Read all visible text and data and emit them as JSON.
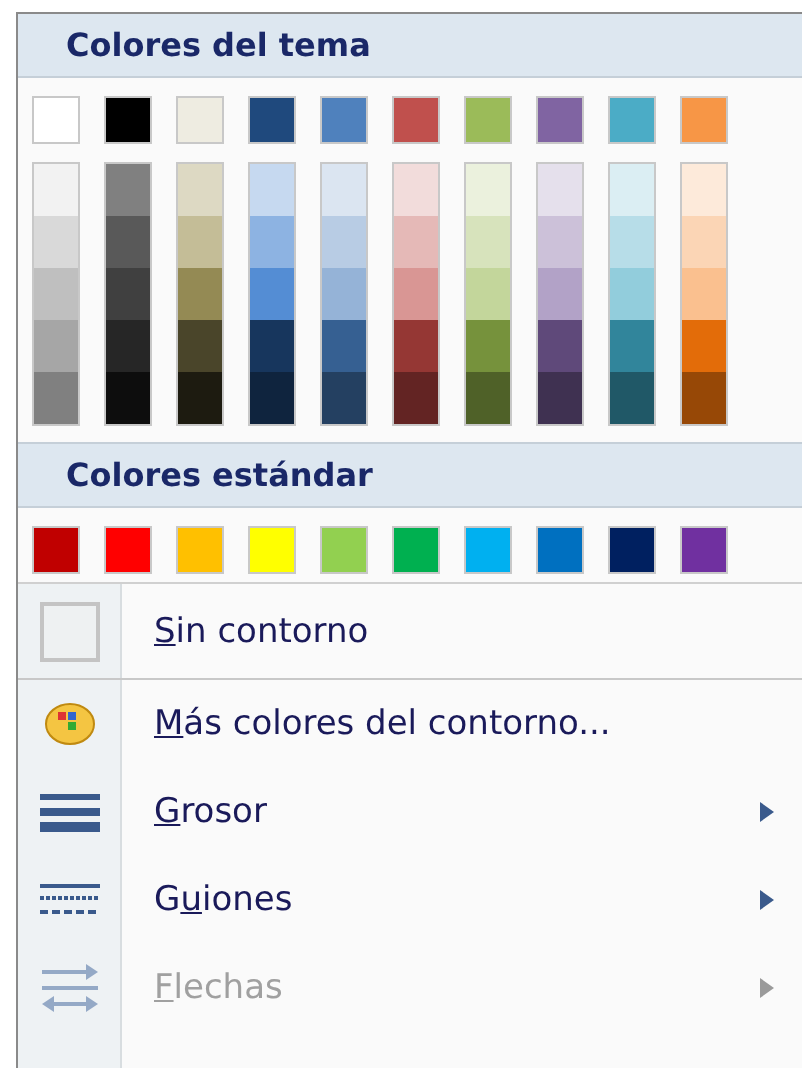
{
  "theme_section": {
    "title": "Colores del tema",
    "base_colors": [
      {
        "color": "#ffffff"
      },
      {
        "color": "#000000"
      },
      {
        "color": "#eeece1"
      },
      {
        "color": "#1f497d"
      },
      {
        "color": "#4f81bd"
      },
      {
        "color": "#c0504d"
      },
      {
        "color": "#9bbb59"
      },
      {
        "color": "#8064a2"
      },
      {
        "color": "#4bacc6"
      },
      {
        "color": "#f79646"
      }
    ],
    "shade_columns": [
      {
        "shades": [
          {
            "color": "#f2f2f2"
          },
          {
            "color": "#d9d9d9"
          },
          {
            "color": "#bfbfbf"
          },
          {
            "color": "#a6a6a6"
          },
          {
            "color": "#808080"
          }
        ]
      },
      {
        "shades": [
          {
            "color": "#808080"
          },
          {
            "color": "#595959"
          },
          {
            "color": "#404040"
          },
          {
            "color": "#262626"
          },
          {
            "color": "#0d0d0d"
          }
        ]
      },
      {
        "shades": [
          {
            "color": "#ddd9c3"
          },
          {
            "color": "#c4bd97"
          },
          {
            "color": "#948a54"
          },
          {
            "color": "#4a452a"
          },
          {
            "color": "#1d1b10"
          }
        ]
      },
      {
        "shades": [
          {
            "color": "#c6d9f0"
          },
          {
            "color": "#8db3e2"
          },
          {
            "color": "#548dd4"
          },
          {
            "color": "#17365d"
          },
          {
            "color": "#0f243e"
          }
        ]
      },
      {
        "shades": [
          {
            "color": "#dbe5f1"
          },
          {
            "color": "#b8cce4"
          },
          {
            "color": "#95b3d7"
          },
          {
            "color": "#366092"
          },
          {
            "color": "#244061"
          }
        ]
      },
      {
        "shades": [
          {
            "color": "#f2dcdb"
          },
          {
            "color": "#e5b9b7"
          },
          {
            "color": "#d99694"
          },
          {
            "color": "#953734"
          },
          {
            "color": "#632423"
          }
        ]
      },
      {
        "shades": [
          {
            "color": "#ebf1dd"
          },
          {
            "color": "#d7e3bc"
          },
          {
            "color": "#c3d69b"
          },
          {
            "color": "#76923c"
          },
          {
            "color": "#4f6128"
          }
        ]
      },
      {
        "shades": [
          {
            "color": "#e5e0ec"
          },
          {
            "color": "#ccc1d9"
          },
          {
            "color": "#b2a2c7"
          },
          {
            "color": "#5f497a"
          },
          {
            "color": "#3f3151"
          }
        ]
      },
      {
        "shades": [
          {
            "color": "#dbeef3"
          },
          {
            "color": "#b7dde8"
          },
          {
            "color": "#92cddc"
          },
          {
            "color": "#31859b"
          },
          {
            "color": "#205867"
          }
        ]
      },
      {
        "shades": [
          {
            "color": "#fdeada"
          },
          {
            "color": "#fbd5b5"
          },
          {
            "color": "#fac08f"
          },
          {
            "color": "#e36c09"
          },
          {
            "color": "#974806"
          }
        ]
      }
    ]
  },
  "standard_section": {
    "title": "Colores estándar",
    "colors": [
      {
        "color": "#c00000"
      },
      {
        "color": "#ff0000"
      },
      {
        "color": "#ffc000"
      },
      {
        "color": "#ffff00"
      },
      {
        "color": "#92d050"
      },
      {
        "color": "#00b050"
      },
      {
        "color": "#00b0f0"
      },
      {
        "color": "#0070c0"
      },
      {
        "color": "#002060"
      },
      {
        "color": "#7030a0"
      }
    ]
  },
  "items": [
    {
      "kind": "none",
      "key": "S",
      "after": "in contorno",
      "has_submenu": false,
      "disabled": false
    },
    {
      "kind": "palette",
      "key": "M",
      "after": "ás colores del contorno...",
      "has_submenu": false,
      "disabled": false
    },
    {
      "kind": "weight",
      "key": "G",
      "after": "rosor",
      "has_submenu": true,
      "disabled": false
    },
    {
      "kind": "dashes",
      "before": "G",
      "key": "u",
      "after": "iones",
      "has_submenu": true,
      "disabled": false
    },
    {
      "kind": "arrows",
      "key": "F",
      "after": "lechas",
      "has_submenu": true,
      "disabled": true
    }
  ]
}
